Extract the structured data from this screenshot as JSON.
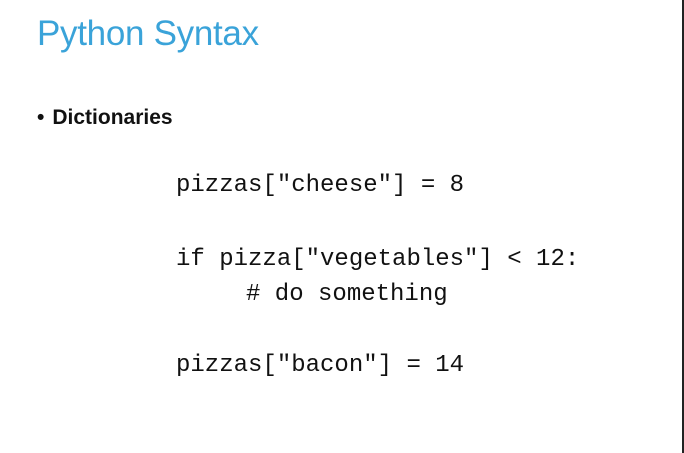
{
  "slide": {
    "title": "Python Syntax",
    "bullet_marker": "•",
    "bullet_text": "Dictionaries",
    "code_lines": [
      "pizzas[\"cheese\"] = 8",
      "if pizza[\"vegetables\"] < 12:",
      "# do something",
      "pizzas[\"bacon\"] = 14"
    ],
    "colors": {
      "title": "#3aa3d9",
      "text": "#111111",
      "background": "#ffffff"
    }
  }
}
